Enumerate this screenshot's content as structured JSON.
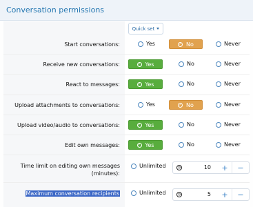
{
  "header": {
    "title": "Conversation permissions"
  },
  "quick_set": {
    "label": "Quick set"
  },
  "rows": [
    {
      "label": "Start conversations:",
      "selected": "No"
    },
    {
      "label": "Receive new conversations:",
      "selected": "Yes"
    },
    {
      "label": "React to messages:",
      "selected": "Yes"
    },
    {
      "label": "Upload attachments to conversations:",
      "selected": "No"
    },
    {
      "label": "Upload video/audio to conversations:",
      "selected": "Yes"
    },
    {
      "label": "Edit own messages:",
      "selected": "Yes"
    }
  ],
  "options": {
    "yes": "Yes",
    "no": "No",
    "never": "Never"
  },
  "time_limit": {
    "label_line1": "Time limit on editing own messages",
    "label_line2": "(minutes):",
    "unlimited": "Unlimited",
    "value": "10",
    "plus": "+",
    "minus": "−"
  },
  "max_recipients": {
    "label": "Maximum conversation recipients",
    "unlimited": "Unlimited",
    "value": "5",
    "plus": "+",
    "minus": "−"
  },
  "icons": {
    "check": "✓",
    "gauge": "◷"
  },
  "colors": {
    "selected_yes": "#58ad3d",
    "selected_no": "#e1a24e",
    "accent": "#2577b1",
    "highlight": "#3b67c6"
  }
}
